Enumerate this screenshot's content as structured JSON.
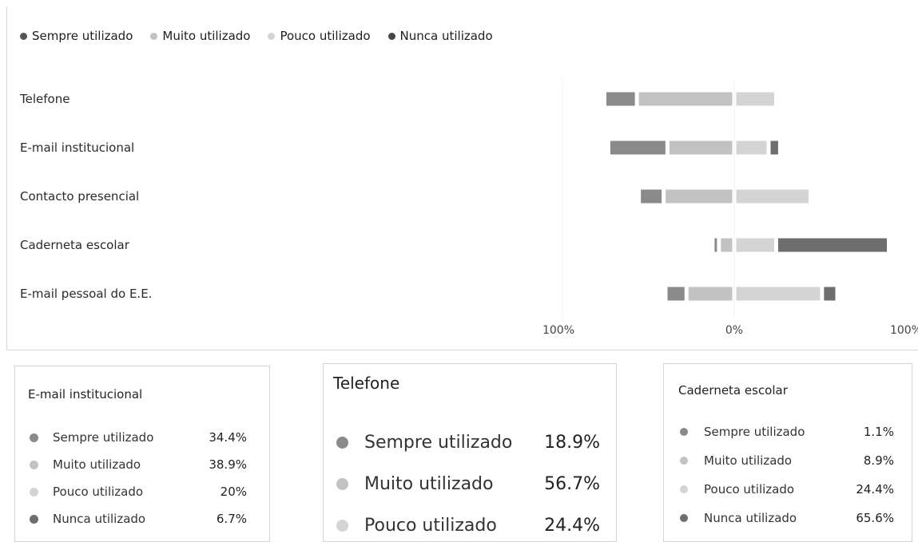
{
  "colors": {
    "sempre": "#8a8a8a",
    "muito": "#c2c2c2",
    "pouco": "#d4d4d4",
    "nunca": "#6e6e6e"
  },
  "chart_data": {
    "type": "bar",
    "orientation": "horizontal-diverging",
    "legend": [
      {
        "label": "Sempre utilizado",
        "key": "sempre"
      },
      {
        "label": "Muito utilizado",
        "key": "muito"
      },
      {
        "label": "Pouco utilizado",
        "key": "pouco"
      },
      {
        "label": "Nunca utilizado",
        "key": "nunca"
      }
    ],
    "legend_position": "top-left",
    "categories": [
      "Telefone",
      "E-mail institucional",
      "Contacto presencial",
      "Caderneta escolar",
      "E-mail pessoal do E.E."
    ],
    "series": [
      {
        "name": "Sempre utilizado",
        "key": "sempre",
        "side": "negative",
        "values": [
          18.9,
          34.4,
          14.4,
          1.1,
          12.2
        ]
      },
      {
        "name": "Muito utilizado",
        "key": "muito",
        "side": "negative",
        "values": [
          56.7,
          38.9,
          41.1,
          8.9,
          27.8
        ]
      },
      {
        "name": "Pouco utilizado",
        "key": "pouco",
        "side": "positive",
        "values": [
          24.4,
          20,
          44.4,
          24.4,
          51.1
        ]
      },
      {
        "name": "Nunca utilizado",
        "key": "nunca",
        "side": "positive",
        "values": [
          0,
          6.7,
          0,
          65.6,
          8.9
        ]
      }
    ],
    "x_ticks": [
      "100%",
      "0%",
      "100%"
    ],
    "xlim": [
      -100,
      100
    ],
    "grid": false
  },
  "cards": [
    {
      "title": "E-mail institucional",
      "rows": [
        {
          "label": "Sempre utilizado",
          "value": "34.4%",
          "key": "sempre"
        },
        {
          "label": "Muito utilizado",
          "value": "38.9%",
          "key": "muito"
        },
        {
          "label": "Pouco utilizado",
          "value": "20%",
          "key": "pouco"
        },
        {
          "label": "Nunca utilizado",
          "value": "6.7%",
          "key": "nunca"
        }
      ]
    },
    {
      "title": "Telefone",
      "rows": [
        {
          "label": "Sempre utilizado",
          "value": "18.9%",
          "key": "sempre"
        },
        {
          "label": "Muito utilizado",
          "value": "56.7%",
          "key": "muito"
        },
        {
          "label": "Pouco utilizado",
          "value": "24.4%",
          "key": "pouco"
        }
      ]
    },
    {
      "title": "Caderneta escolar",
      "rows": [
        {
          "label": "Sempre utilizado",
          "value": "1.1%",
          "key": "sempre"
        },
        {
          "label": "Muito utilizado",
          "value": "8.9%",
          "key": "muito"
        },
        {
          "label": "Pouco utilizado",
          "value": "24.4%",
          "key": "pouco"
        },
        {
          "label": "Nunca utilizado",
          "value": "65.6%",
          "key": "nunca"
        }
      ]
    }
  ]
}
